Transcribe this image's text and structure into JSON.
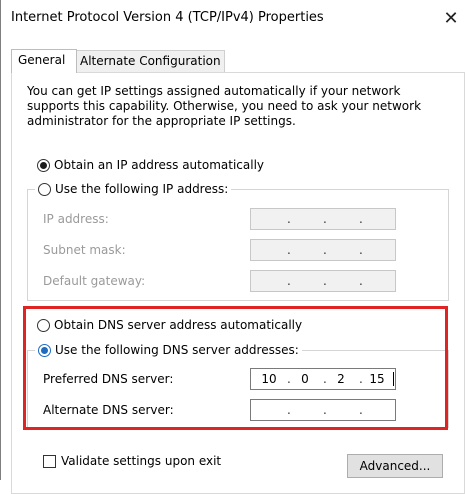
{
  "window": {
    "title": "Internet Protocol Version 4 (TCP/IPv4) Properties",
    "close_glyph": "✕"
  },
  "tabs": [
    {
      "label": "General",
      "active": true
    },
    {
      "label": "Alternate Configuration",
      "active": false
    }
  ],
  "description": "You can get IP settings assigned automatically if your network supports this capability. Otherwise, you need to ask your network administrator for the appropriate IP settings.",
  "ip_section": {
    "auto_label": "Obtain an IP address automatically",
    "manual_label": "Use the following IP address:",
    "auto_selected": true,
    "fields": [
      {
        "label": "IP address:",
        "octets": [
          "",
          "",
          "",
          ""
        ],
        "enabled": false
      },
      {
        "label": "Subnet mask:",
        "octets": [
          "",
          "",
          "",
          ""
        ],
        "enabled": false
      },
      {
        "label": "Default gateway:",
        "octets": [
          "",
          "",
          "",
          ""
        ],
        "enabled": false
      }
    ]
  },
  "dns_section": {
    "auto_label": "Obtain DNS server address automatically",
    "manual_label": "Use the following DNS server addresses:",
    "manual_selected": true,
    "fields": [
      {
        "label": "Preferred DNS server:",
        "octets": [
          "10",
          "0",
          "2",
          "15"
        ],
        "enabled": true
      },
      {
        "label": "Alternate DNS server:",
        "octets": [
          "",
          "",
          "",
          ""
        ],
        "enabled": true
      }
    ],
    "highlight_color": "#e02424"
  },
  "validate": {
    "label": "Validate settings upon exit",
    "checked": false
  },
  "advanced_button": {
    "label": "Advanced..."
  }
}
